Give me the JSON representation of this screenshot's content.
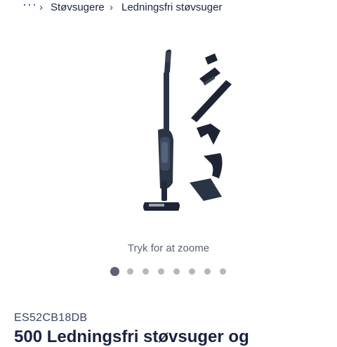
{
  "breadcrumb": {
    "more_label": "···",
    "items": [
      {
        "label": "Støvsugere"
      },
      {
        "label": "Ledningsfri støvsuger"
      }
    ]
  },
  "gallery": {
    "zoom_hint": "Tryk for at zoome",
    "slide_count": 8,
    "active_slide": 1
  },
  "product": {
    "sku": "ES52CB18DB",
    "title": "500 Ledningsfri støvsuger og"
  },
  "colors": {
    "accent": "#1a3bb3",
    "product_body": "#2b3445",
    "dot_active": "#5e6271",
    "dot_inactive": "#b3b7c2"
  }
}
